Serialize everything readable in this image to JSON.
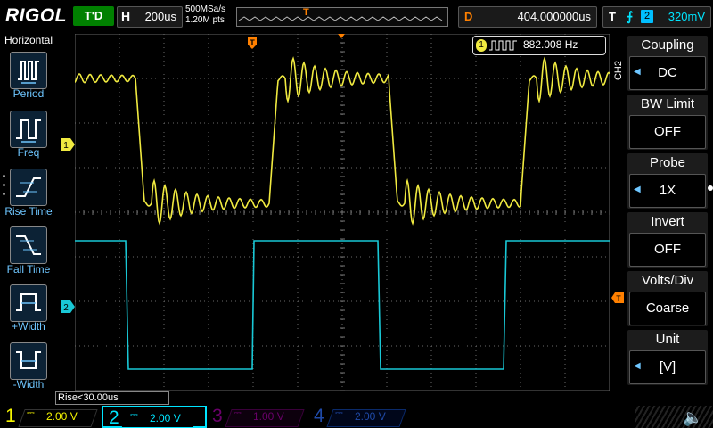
{
  "brand": "RIGOL",
  "run_status": "T'D",
  "timebase": {
    "label": "H",
    "value": "200us"
  },
  "sample": {
    "rate": "500MSa/s",
    "points": "1.20M pts"
  },
  "memory_trigger_marker": "T",
  "delay": {
    "label": "D",
    "value": "404.000000us"
  },
  "trigger": {
    "label": "T",
    "edge_icon": "rising-edge-icon",
    "source": "2",
    "level": "320mV"
  },
  "left_menu": {
    "title": "Horizontal",
    "items": [
      {
        "label": "Period",
        "icon": "period-icon"
      },
      {
        "label": "Freq",
        "icon": "freq-icon"
      },
      {
        "label": "Rise Time",
        "icon": "rise-time-icon"
      },
      {
        "label": "Fall Time",
        "icon": "fall-time-icon"
      },
      {
        "label": "+Width",
        "icon": "pos-width-icon"
      },
      {
        "label": "-Width",
        "icon": "neg-width-icon"
      }
    ]
  },
  "right_menu": {
    "channel_tag": "CH2",
    "items": [
      {
        "title": "Coupling",
        "value": "DC"
      },
      {
        "title": "BW Limit",
        "value": "OFF"
      },
      {
        "title": "Probe",
        "value": "1X"
      },
      {
        "title": "Invert",
        "value": "OFF"
      },
      {
        "title": "Volts/Div",
        "value": "Coarse"
      },
      {
        "title": "Unit",
        "value": "[V]"
      }
    ]
  },
  "measurement": {
    "channel": "1",
    "value": "882.008 Hz"
  },
  "markers": {
    "ch1": "1",
    "ch2": "2",
    "trigger_top": "T"
  },
  "rise_readout": "Rise<30.00us",
  "channels": [
    {
      "num": "1",
      "scale": "2.00 V",
      "color": "#f5f500",
      "active": true
    },
    {
      "num": "2",
      "scale": "2.00 V",
      "color": "#00e5ff",
      "active": true
    },
    {
      "num": "3",
      "scale": "1.00 V",
      "color": "#b000b0",
      "active": false
    },
    {
      "num": "4",
      "scale": "2.00 V",
      "color": "#2a6aff",
      "active": false
    }
  ],
  "colors": {
    "ch1": "#f0ea40",
    "ch2": "#19c8d6",
    "trigger": "#ff8000",
    "menu_accent": "#6ec6ff"
  }
}
